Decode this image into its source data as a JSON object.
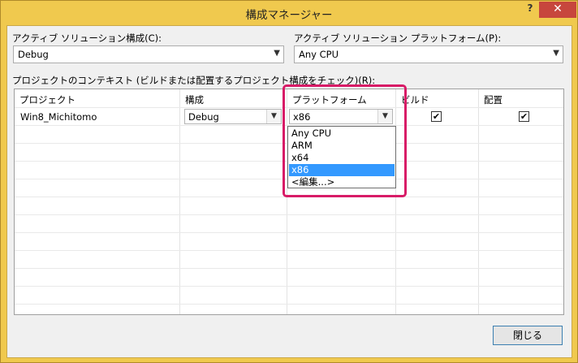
{
  "window": {
    "title": "構成マネージャー",
    "help": "?",
    "close": "✕"
  },
  "active_config": {
    "label": "アクティブ ソリューション構成(C):",
    "value": "Debug"
  },
  "active_platform": {
    "label": "アクティブ ソリューション プラットフォーム(P):",
    "value": "Any CPU"
  },
  "grid": {
    "caption": "プロジェクトのコンテキスト (ビルドまたは配置するプロジェクト構成をチェック)(R):",
    "headers": [
      "プロジェクト",
      "構成",
      "プラットフォーム",
      "ビルド",
      "配置"
    ],
    "row": {
      "project": "Win8_Michitomo",
      "config": "Debug",
      "platform": "x86",
      "build": "✔",
      "deploy": "✔"
    }
  },
  "platform_dropdown": {
    "options": [
      "Any CPU",
      "ARM",
      "x64",
      "x86",
      "<編集...>"
    ],
    "selected": "x86"
  },
  "close_button": "閉じる",
  "icons": {
    "dropdown": "chevron-down-icon",
    "check": "checkmark-icon"
  },
  "colors": {
    "title_bar": "#f0c94e",
    "close_button": "#c7463d",
    "selection": "#3399ff",
    "highlight_frame": "#d81b67"
  }
}
